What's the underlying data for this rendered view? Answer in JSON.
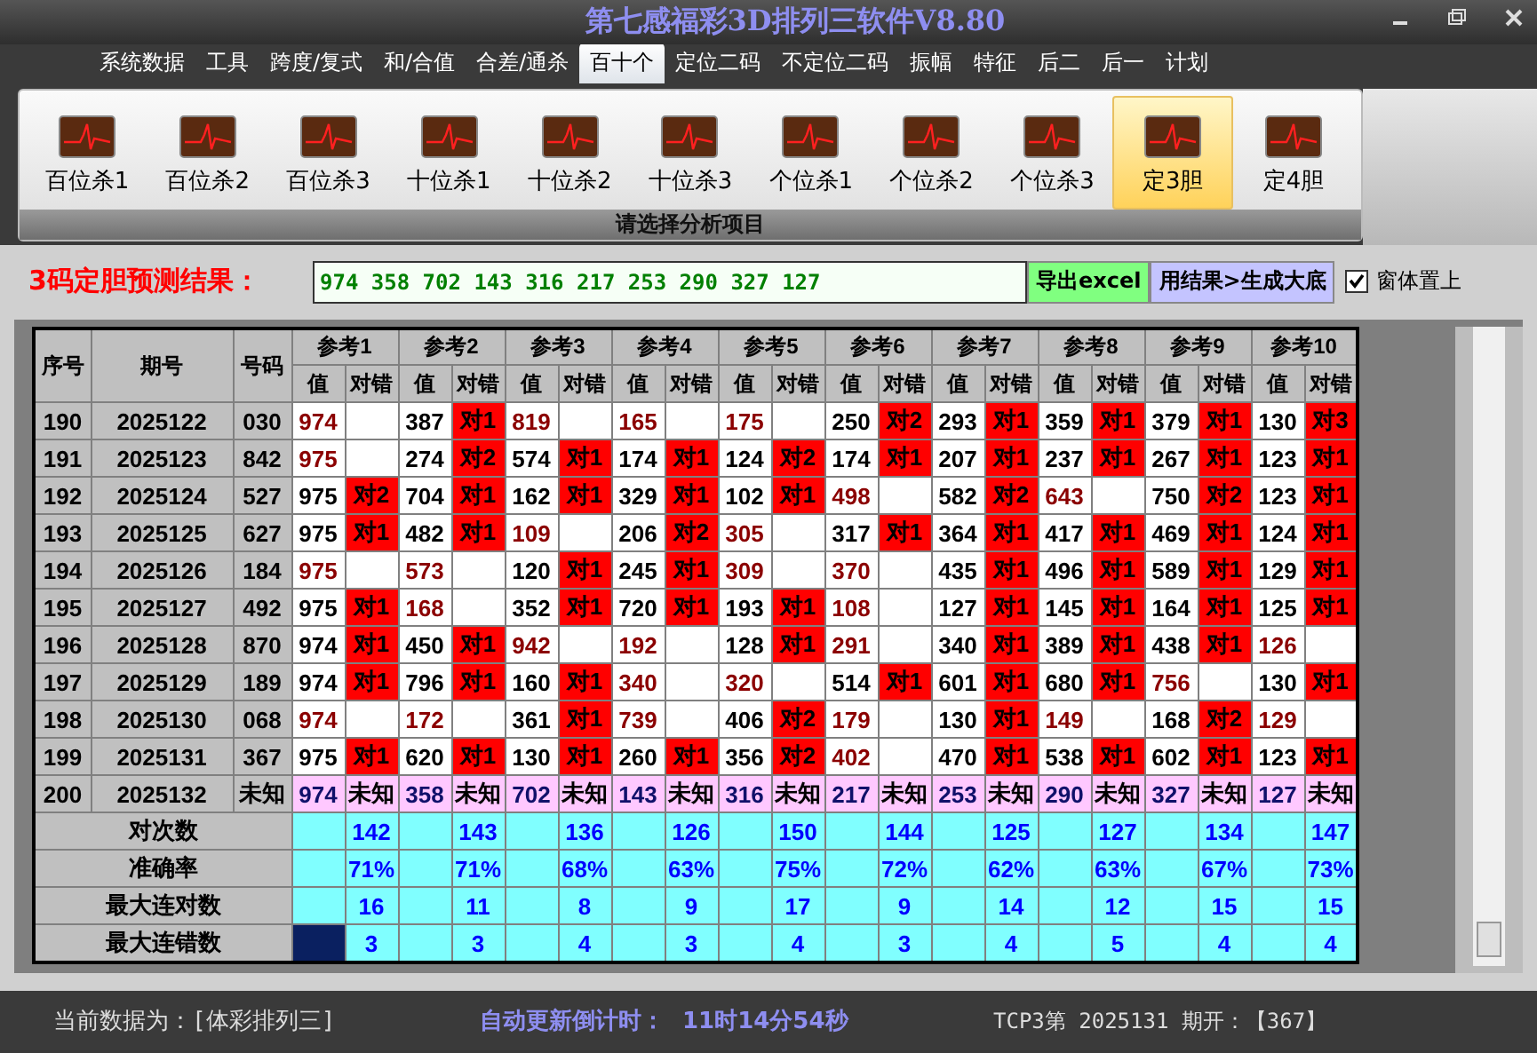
{
  "window": {
    "title": "第七感福彩3D排列三软件V8.80"
  },
  "menu": [
    {
      "label": "系统数据",
      "selected": false
    },
    {
      "label": "工具",
      "selected": false
    },
    {
      "label": "跨度/复式",
      "selected": false
    },
    {
      "label": "和/合值",
      "selected": false
    },
    {
      "label": "合差/通杀",
      "selected": false
    },
    {
      "label": "百十个",
      "selected": true
    },
    {
      "label": "定位二码",
      "selected": false
    },
    {
      "label": "不定位二码",
      "selected": false
    },
    {
      "label": "振幅",
      "selected": false
    },
    {
      "label": "特征",
      "selected": false
    },
    {
      "label": "后二",
      "selected": false
    },
    {
      "label": "后一",
      "selected": false
    },
    {
      "label": "计划",
      "selected": false
    }
  ],
  "ribbon": {
    "items": [
      {
        "label": "百位杀1",
        "selected": false
      },
      {
        "label": "百位杀2",
        "selected": false
      },
      {
        "label": "百位杀3",
        "selected": false
      },
      {
        "label": "十位杀1",
        "selected": false
      },
      {
        "label": "十位杀2",
        "selected": false
      },
      {
        "label": "十位杀3",
        "selected": false
      },
      {
        "label": "个位杀1",
        "selected": false
      },
      {
        "label": "个位杀2",
        "selected": false
      },
      {
        "label": "个位杀3",
        "selected": false
      },
      {
        "label": "定3胆",
        "selected": true
      },
      {
        "label": "定4胆",
        "selected": false
      }
    ],
    "group_label": "请选择分析项目"
  },
  "result_bar": {
    "label": "3码定胆预测结果：",
    "value": "974 358 702 143 316 217 253 290 327 127",
    "buttons": [
      {
        "kind": "export",
        "label": "导出excel"
      },
      {
        "kind": "generate",
        "label": "用结果>生成大底"
      }
    ],
    "checkbox": {
      "label": "窗体置上",
      "checked": true
    }
  },
  "table": {
    "columns": [
      "序号",
      "期号",
      "号码"
    ],
    "ref_headers": [
      {
        "label": "参考1",
        "sub": [
          "值",
          "对错"
        ]
      },
      {
        "label": "参考2",
        "sub": [
          "值",
          "对错"
        ]
      },
      {
        "label": "参考3",
        "sub": [
          "值",
          "对错"
        ]
      },
      {
        "label": "参考4",
        "sub": [
          "值",
          "对错"
        ]
      },
      {
        "label": "参考5",
        "sub": [
          "值",
          "对错"
        ]
      },
      {
        "label": "参考6",
        "sub": [
          "值",
          "对错"
        ]
      },
      {
        "label": "参考7",
        "sub": [
          "值",
          "对错"
        ]
      },
      {
        "label": "参考8",
        "sub": [
          "值",
          "对错"
        ]
      },
      {
        "label": "参考9",
        "sub": [
          "值",
          "对错"
        ]
      },
      {
        "label": "参考10",
        "sub": [
          "值",
          "对错"
        ]
      }
    ],
    "rows": [
      {
        "kind": "history",
        "index": "190",
        "issue": "2025122",
        "number": "030",
        "cells": [
          {
            "value": "974",
            "hit": false
          },
          {
            "value": "387",
            "hit": true,
            "result": "对1"
          },
          {
            "value": "819",
            "hit": false
          },
          {
            "value": "165",
            "hit": false
          },
          {
            "value": "175",
            "hit": false
          },
          {
            "value": "250",
            "hit": true,
            "result": "对2"
          },
          {
            "value": "293",
            "hit": true,
            "result": "对1"
          },
          {
            "value": "359",
            "hit": true,
            "result": "对1"
          },
          {
            "value": "379",
            "hit": true,
            "result": "对1"
          },
          {
            "value": "130",
            "hit": true,
            "result": "对3"
          }
        ]
      },
      {
        "kind": "history",
        "index": "191",
        "issue": "2025123",
        "number": "842",
        "cells": [
          {
            "value": "975",
            "hit": false
          },
          {
            "value": "274",
            "hit": true,
            "result": "对2"
          },
          {
            "value": "574",
            "hit": true,
            "result": "对1"
          },
          {
            "value": "174",
            "hit": true,
            "result": "对1"
          },
          {
            "value": "124",
            "hit": true,
            "result": "对2"
          },
          {
            "value": "174",
            "hit": true,
            "result": "对1"
          },
          {
            "value": "207",
            "hit": true,
            "result": "对1"
          },
          {
            "value": "237",
            "hit": true,
            "result": "对1"
          },
          {
            "value": "267",
            "hit": true,
            "result": "对1"
          },
          {
            "value": "123",
            "hit": true,
            "result": "对1"
          }
        ]
      },
      {
        "kind": "history",
        "index": "192",
        "issue": "2025124",
        "number": "527",
        "cells": [
          {
            "value": "975",
            "hit": true,
            "result": "对2"
          },
          {
            "value": "704",
            "hit": true,
            "result": "对1"
          },
          {
            "value": "162",
            "hit": true,
            "result": "对1"
          },
          {
            "value": "329",
            "hit": true,
            "result": "对1"
          },
          {
            "value": "102",
            "hit": true,
            "result": "对1"
          },
          {
            "value": "498",
            "hit": false
          },
          {
            "value": "582",
            "hit": true,
            "result": "对2"
          },
          {
            "value": "643",
            "hit": false
          },
          {
            "value": "750",
            "hit": true,
            "result": "对2"
          },
          {
            "value": "123",
            "hit": true,
            "result": "对1"
          }
        ]
      },
      {
        "kind": "history",
        "index": "193",
        "issue": "2025125",
        "number": "627",
        "cells": [
          {
            "value": "975",
            "hit": true,
            "result": "对1"
          },
          {
            "value": "482",
            "hit": true,
            "result": "对1"
          },
          {
            "value": "109",
            "hit": false
          },
          {
            "value": "206",
            "hit": true,
            "result": "对2"
          },
          {
            "value": "305",
            "hit": false
          },
          {
            "value": "317",
            "hit": true,
            "result": "对1"
          },
          {
            "value": "364",
            "hit": true,
            "result": "对1"
          },
          {
            "value": "417",
            "hit": true,
            "result": "对1"
          },
          {
            "value": "469",
            "hit": true,
            "result": "对1"
          },
          {
            "value": "124",
            "hit": true,
            "result": "对1"
          }
        ]
      },
      {
        "kind": "history",
        "index": "194",
        "issue": "2025126",
        "number": "184",
        "cells": [
          {
            "value": "975",
            "hit": false
          },
          {
            "value": "573",
            "hit": false
          },
          {
            "value": "120",
            "hit": true,
            "result": "对1"
          },
          {
            "value": "245",
            "hit": true,
            "result": "对1"
          },
          {
            "value": "309",
            "hit": false
          },
          {
            "value": "370",
            "hit": false
          },
          {
            "value": "435",
            "hit": true,
            "result": "对1"
          },
          {
            "value": "496",
            "hit": true,
            "result": "对1"
          },
          {
            "value": "589",
            "hit": true,
            "result": "对1"
          },
          {
            "value": "129",
            "hit": true,
            "result": "对1"
          }
        ]
      },
      {
        "kind": "history",
        "index": "195",
        "issue": "2025127",
        "number": "492",
        "cells": [
          {
            "value": "975",
            "hit": true,
            "result": "对1"
          },
          {
            "value": "168",
            "hit": false
          },
          {
            "value": "352",
            "hit": true,
            "result": "对1"
          },
          {
            "value": "720",
            "hit": true,
            "result": "对1"
          },
          {
            "value": "193",
            "hit": true,
            "result": "对1"
          },
          {
            "value": "108",
            "hit": false
          },
          {
            "value": "127",
            "hit": true,
            "result": "对1"
          },
          {
            "value": "145",
            "hit": true,
            "result": "对1"
          },
          {
            "value": "164",
            "hit": true,
            "result": "对1"
          },
          {
            "value": "125",
            "hit": true,
            "result": "对1"
          }
        ]
      },
      {
        "kind": "history",
        "index": "196",
        "issue": "2025128",
        "number": "870",
        "cells": [
          {
            "value": "974",
            "hit": true,
            "result": "对1"
          },
          {
            "value": "450",
            "hit": true,
            "result": "对1"
          },
          {
            "value": "942",
            "hit": false
          },
          {
            "value": "192",
            "hit": false
          },
          {
            "value": "128",
            "hit": true,
            "result": "对1"
          },
          {
            "value": "291",
            "hit": false
          },
          {
            "value": "340",
            "hit": true,
            "result": "对1"
          },
          {
            "value": "389",
            "hit": true,
            "result": "对1"
          },
          {
            "value": "438",
            "hit": true,
            "result": "对1"
          },
          {
            "value": "126",
            "hit": false
          }
        ]
      },
      {
        "kind": "history",
        "index": "197",
        "issue": "2025129",
        "number": "189",
        "cells": [
          {
            "value": "974",
            "hit": true,
            "result": "对1"
          },
          {
            "value": "796",
            "hit": true,
            "result": "对1"
          },
          {
            "value": "160",
            "hit": true,
            "result": "对1"
          },
          {
            "value": "340",
            "hit": false
          },
          {
            "value": "320",
            "hit": false
          },
          {
            "value": "514",
            "hit": true,
            "result": "对1"
          },
          {
            "value": "601",
            "hit": true,
            "result": "对1"
          },
          {
            "value": "680",
            "hit": true,
            "result": "对1"
          },
          {
            "value": "756",
            "hit": false
          },
          {
            "value": "130",
            "hit": true,
            "result": "对1"
          }
        ]
      },
      {
        "kind": "history",
        "index": "198",
        "issue": "2025130",
        "number": "068",
        "cells": [
          {
            "value": "974",
            "hit": false
          },
          {
            "value": "172",
            "hit": false
          },
          {
            "value": "361",
            "hit": true,
            "result": "对1"
          },
          {
            "value": "739",
            "hit": false
          },
          {
            "value": "406",
            "hit": true,
            "result": "对2"
          },
          {
            "value": "179",
            "hit": false
          },
          {
            "value": "130",
            "hit": true,
            "result": "对1"
          },
          {
            "value": "149",
            "hit": false
          },
          {
            "value": "168",
            "hit": true,
            "result": "对2"
          },
          {
            "value": "129",
            "hit": false
          }
        ]
      },
      {
        "kind": "history",
        "index": "199",
        "issue": "2025131",
        "number": "367",
        "cells": [
          {
            "value": "975",
            "hit": true,
            "result": "对1"
          },
          {
            "value": "620",
            "hit": true,
            "result": "对1"
          },
          {
            "value": "130",
            "hit": true,
            "result": "对1"
          },
          {
            "value": "260",
            "hit": true,
            "result": "对1"
          },
          {
            "value": "356",
            "hit": true,
            "result": "对2"
          },
          {
            "value": "402",
            "hit": false
          },
          {
            "value": "470",
            "hit": true,
            "result": "对1"
          },
          {
            "value": "538",
            "hit": true,
            "result": "对1"
          },
          {
            "value": "602",
            "hit": true,
            "result": "对1"
          },
          {
            "value": "123",
            "hit": true,
            "result": "对1"
          }
        ]
      },
      {
        "kind": "pending",
        "index": "200",
        "issue": "2025132",
        "number": "未知",
        "cells": [
          {
            "value": "974",
            "result": "未知"
          },
          {
            "value": "358",
            "result": "未知"
          },
          {
            "value": "702",
            "result": "未知"
          },
          {
            "value": "143",
            "result": "未知"
          },
          {
            "value": "316",
            "result": "未知"
          },
          {
            "value": "217",
            "result": "未知"
          },
          {
            "value": "253",
            "result": "未知"
          },
          {
            "value": "290",
            "result": "未知"
          },
          {
            "value": "327",
            "result": "未知"
          },
          {
            "value": "127",
            "result": "未知"
          }
        ]
      }
    ],
    "stats": [
      {
        "label": "对次数",
        "selected": false,
        "values": [
          "142",
          "143",
          "136",
          "126",
          "150",
          "144",
          "125",
          "127",
          "134",
          "147"
        ]
      },
      {
        "label": "准确率",
        "selected": false,
        "values": [
          "71%",
          "71%",
          "68%",
          "63%",
          "75%",
          "72%",
          "62%",
          "63%",
          "67%",
          "73%"
        ]
      },
      {
        "label": "最大连对数",
        "selected": false,
        "values": [
          "16",
          "11",
          "8",
          "9",
          "17",
          "9",
          "14",
          "12",
          "15",
          "15"
        ]
      },
      {
        "label": "最大连错数",
        "selected": true,
        "values": [
          "3",
          "3",
          "4",
          "3",
          "4",
          "3",
          "4",
          "5",
          "4",
          "4"
        ]
      }
    ]
  },
  "status_bar": {
    "data_source": "当前数据为：[体彩排列三]",
    "countdown_label": "自动更新倒计时：",
    "countdown": "11时14分54秒",
    "latest": "TCP3第 2025131 期开：【367】"
  }
}
